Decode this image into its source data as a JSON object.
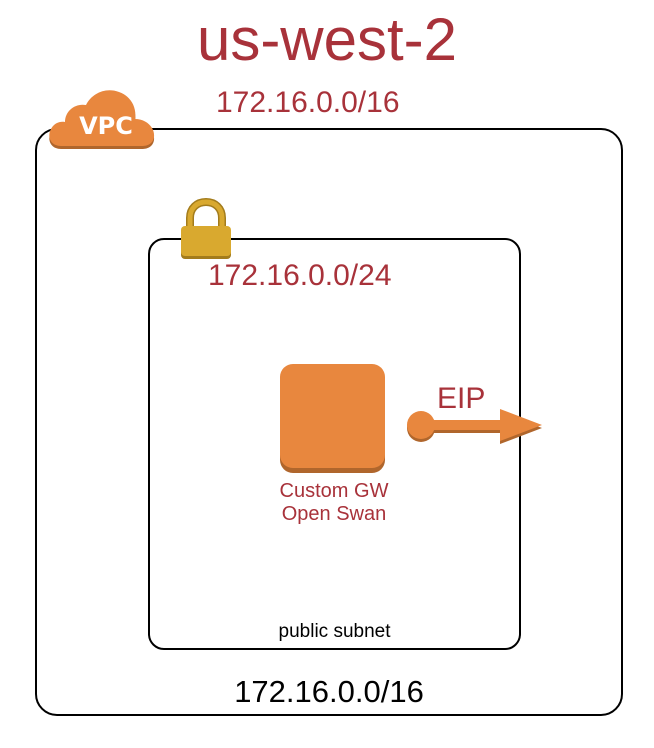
{
  "region": {
    "title": "us-west-2"
  },
  "vpc": {
    "badge_label": "VPC",
    "cidr_top": "172.16.0.0/16",
    "cidr_bottom": "172.16.0.0/16",
    "icon": "vpc-cloud-icon"
  },
  "subnet": {
    "cidr": "172.16.0.0/24",
    "name": "public subnet",
    "icon": "lock-icon"
  },
  "instance": {
    "label_line1": "Custom GW",
    "label_line2": "Open Swan",
    "icon": "instance-icon"
  },
  "eip": {
    "label": "EIP",
    "icon": "arrow-right-icon"
  },
  "colors": {
    "accent_text": "#a8323a",
    "aws_orange": "#e8873e",
    "aws_orange_dark": "#b0662c",
    "lock_gold": "#d9a92f",
    "lock_gold_dark": "#a37c1c",
    "border": "#000000"
  }
}
